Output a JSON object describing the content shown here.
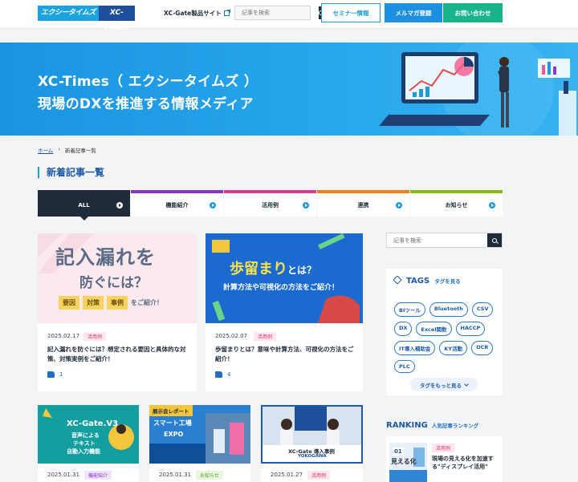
{
  "header": {
    "logo_jp": "エクシータイムズ",
    "logo_en": "XC-Times",
    "product_link": "XC-Gate製品サイト",
    "search_placeholder": "記事を検索",
    "btn_seminar": "セミナー情報",
    "btn_mail": "メルマガ登録",
    "btn_contact": "お問い合わせ"
  },
  "hero": {
    "line1": "XC-Times（ エクシータイムズ ）",
    "line2": "現場のDXを推進する情報メディア"
  },
  "breadcrumb": {
    "home": "ホーム",
    "current": "新着記事一覧"
  },
  "page_title": "新着記事一覧",
  "tabs": [
    {
      "label": "ALL",
      "color": "#1f2b3a"
    },
    {
      "label": "機能紹介",
      "color": "#8a34c8"
    },
    {
      "label": "活用例",
      "color": "#d83a8c"
    },
    {
      "label": "連携",
      "color": "#ef7f1a"
    },
    {
      "label": "お知らせ",
      "color": "#86b818"
    }
  ],
  "articles": [
    {
      "img_text": {
        "l1": "記入漏れを",
        "l2": "防ぐには？",
        "chips": [
          "要因",
          "対策",
          "事例"
        ],
        "tail": "をご紹介！"
      },
      "date": "2025.02.17",
      "category": "活用例",
      "title": "記入漏れを防ぐには？想定される要因と具体的な対策、対策実例をご紹介！",
      "likes": "1"
    },
    {
      "img_text": {
        "l1": "歩留まり",
        "l1b": "とは？",
        "l2": "計算方法や可視化の方法をご紹介！"
      },
      "date": "2025.02.07",
      "category": "活用例",
      "title": "歩留まりとは？意味や計算方法、可視化の方法をご紹介！",
      "likes": "4"
    },
    {
      "img_text": {
        "l1": "XC-Gate.V3",
        "l2": "音声による",
        "l3": "テキスト",
        "l4": "自動入力機能"
      },
      "date": "2025.01.31",
      "category": "機能紹介"
    },
    {
      "img_text": {
        "badge": "展示会レポート",
        "l1": "スマート工場",
        "l2": "EXPO"
      },
      "date": "2025.01.31",
      "category": "お知らせ"
    },
    {
      "img_text": {
        "l1": "XC-Gate 導入事例",
        "l2": "YOKOGAWA"
      },
      "date": "2025.01.27",
      "category": "活用例"
    }
  ],
  "sidebar": {
    "search_placeholder": "記事を検索",
    "tags_heading": "TAGS",
    "tags_sub": "タグを見る",
    "tags": [
      "BIツール",
      "Bluetooth",
      "CSV",
      "DX",
      "Excel関数",
      "HACCP",
      "IT導入補助金",
      "KY活動",
      "OCR",
      "PLC"
    ],
    "more_tags": "タグをもっと見る",
    "ranking_heading": "RANKING",
    "ranking_sub": "人気記事ランキング",
    "ranking_item": {
      "rank": "01",
      "img_text": "見える化",
      "category": "活用例",
      "title": "現場の見える化を加速する\"ディスプレイ活用\""
    }
  }
}
